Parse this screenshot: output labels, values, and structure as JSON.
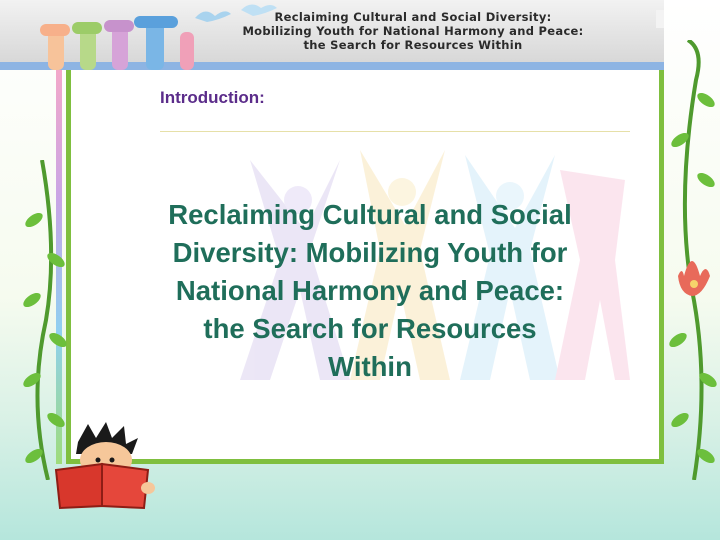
{
  "banner": {
    "lines": [
      "Reclaiming Cultural and Social Diversity:",
      "Mobilizing Youth for National Harmony and Peace:",
      "the Search for Resources Within"
    ]
  },
  "slide": {
    "heading": "Introduction:",
    "title_lines": [
      "Reclaiming Cultural and Social",
      "Diversity: Mobilizing Youth for",
      "National Harmony and Peace:",
      "the Search for Resources",
      "Within"
    ]
  },
  "colors": {
    "heading": "#5b2c8a",
    "title": "#1f6e5a",
    "frame": "#7fbf3f",
    "banner_stripe": "#8db4e3"
  },
  "decorations": [
    "raised-hands-icon",
    "doves-icon",
    "vine-icon",
    "child-reading-icon",
    "dancing-people-icon"
  ]
}
